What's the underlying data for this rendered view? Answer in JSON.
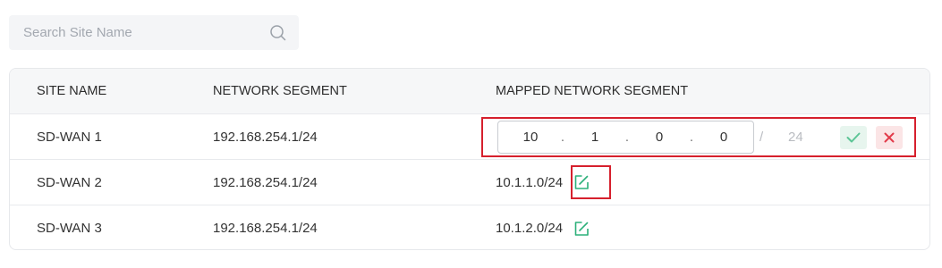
{
  "search": {
    "placeholder": "Search Site Name",
    "value": "",
    "icon": "search-icon"
  },
  "table": {
    "columns": [
      "SITE NAME",
      "NETWORK SEGMENT",
      "MAPPED NETWORK SEGMENT"
    ],
    "rows": [
      {
        "site_name": "SD-WAN 1",
        "network_segment": "192.168.254.1/24",
        "editing": true,
        "mapped_octets": [
          "10",
          "1",
          "0",
          "0"
        ],
        "separator": ".",
        "prefix_separator": "/",
        "prefix": "24"
      },
      {
        "site_name": "SD-WAN 2",
        "network_segment": "192.168.254.1/24",
        "mapped": "10.1.1.0/24",
        "icon": "edit-icon"
      },
      {
        "site_name": "SD-WAN 3",
        "network_segment": "192.168.254.1/24",
        "mapped": "10.1.2.0/24",
        "icon": "edit-icon"
      }
    ]
  },
  "colors": {
    "accent_green": "#2cb07a",
    "highlight_red": "#d6202d",
    "cancel_red": "#e23b4a"
  }
}
